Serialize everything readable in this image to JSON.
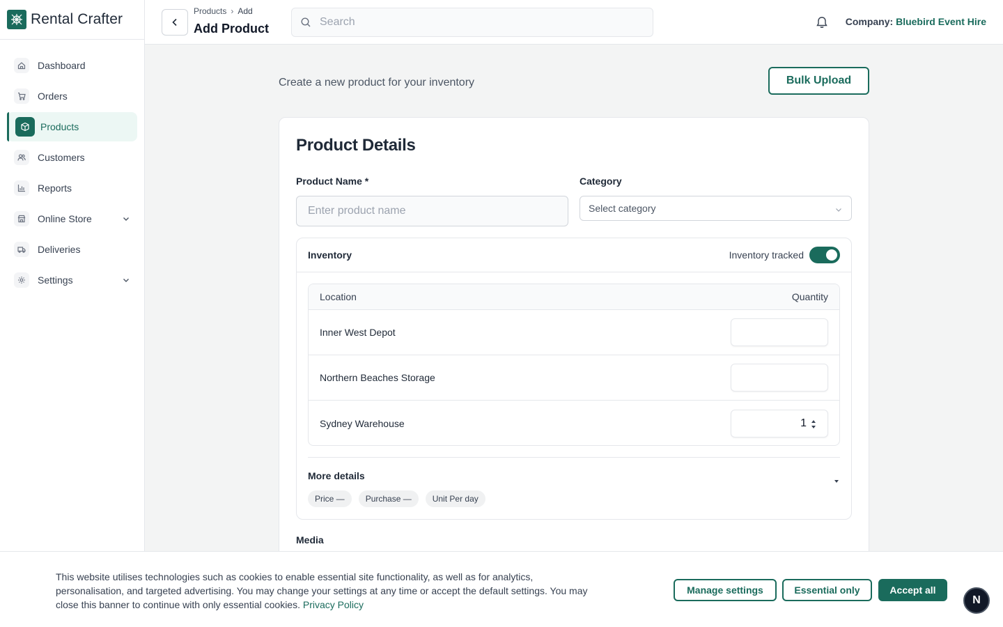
{
  "app": {
    "name": "Rental Crafter"
  },
  "sidebar": {
    "items": [
      {
        "label": "Dashboard",
        "icon": "home-icon"
      },
      {
        "label": "Orders",
        "icon": "cart-icon"
      },
      {
        "label": "Products",
        "icon": "box-icon",
        "active": true
      },
      {
        "label": "Customers",
        "icon": "users-icon"
      },
      {
        "label": "Reports",
        "icon": "bar-chart-icon"
      },
      {
        "label": "Online Store",
        "icon": "store-icon",
        "expandable": true
      },
      {
        "label": "Deliveries",
        "icon": "truck-icon"
      },
      {
        "label": "Settings",
        "icon": "gear-icon",
        "expandable": true
      }
    ]
  },
  "header": {
    "breadcrumb": [
      "Products",
      "Add"
    ],
    "title": "Add Product",
    "search_placeholder": "Search",
    "company_label": "Company:",
    "company_name": "Bluebird Event Hire"
  },
  "main": {
    "subtitle": "Create a new product for your inventory",
    "bulk_upload_label": "Bulk Upload",
    "card_title": "Product Details",
    "product_name_label": "Product Name *",
    "product_name_placeholder": "Enter product name",
    "category_label": "Category",
    "category_placeholder": "Select category",
    "inventory": {
      "title": "Inventory",
      "tracked_label": "Inventory tracked",
      "tracked": true,
      "columns": [
        "Location",
        "Quantity"
      ],
      "rows": [
        {
          "location": "Inner West Depot",
          "quantity": ""
        },
        {
          "location": "Northern Beaches Storage",
          "quantity": ""
        },
        {
          "location": "Sydney Warehouse",
          "quantity": "1"
        }
      ]
    },
    "more_details": {
      "title": "More details",
      "chips": [
        "Price —",
        "Purchase —",
        "Unit Per day"
      ]
    },
    "media_label": "Media"
  },
  "cookie_banner": {
    "text": "This website utilises technologies such as cookies to enable essential site functionality, as well as for analytics, personalisation, and targeted advertising. You may change your settings at any time or accept the default settings. You may close this banner to continue with only essential cookies.",
    "privacy_link": "Privacy Policy",
    "buttons": {
      "manage": "Manage settings",
      "essential": "Essential only",
      "accept": "Accept all"
    }
  },
  "floating_badge": "N",
  "colors": {
    "accent": "#1a6b5c",
    "background": "#f3f4f4"
  }
}
